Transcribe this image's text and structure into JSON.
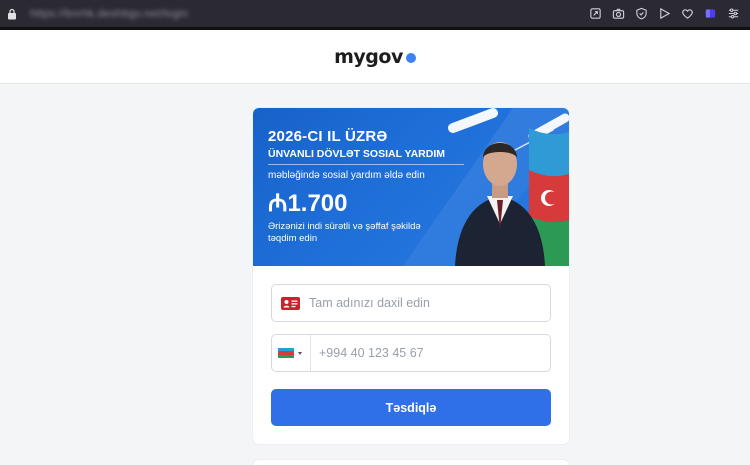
{
  "browser": {
    "url": "https://bnrhk.deshbgv.net/login",
    "icons": [
      "lock-icon",
      "share-icon",
      "camera-icon",
      "shield-icon",
      "play-icon",
      "heart-icon",
      "extension-icon",
      "menu-icon"
    ]
  },
  "header": {
    "logo_text": "mygov",
    "accent": "#3d82f5"
  },
  "banner": {
    "title": "2026-CI IL ÜZRƏ",
    "subtitle": "ÜNVANLI DÖVLƏT SOSIAL YARDIM",
    "description": "məbləğində sosial yardım əldə edin",
    "amount": "₼1.700",
    "note": "Ərizənizi indi sürətli və şəffaf şəkildə təqdim edin"
  },
  "form": {
    "name_placeholder": "Tam adınızı daxil edin",
    "phone_placeholder": "+994 40 123 45 67",
    "country_flag": "az",
    "submit_label": "Təsdiqlə",
    "button_color": "#2f6fe8"
  }
}
